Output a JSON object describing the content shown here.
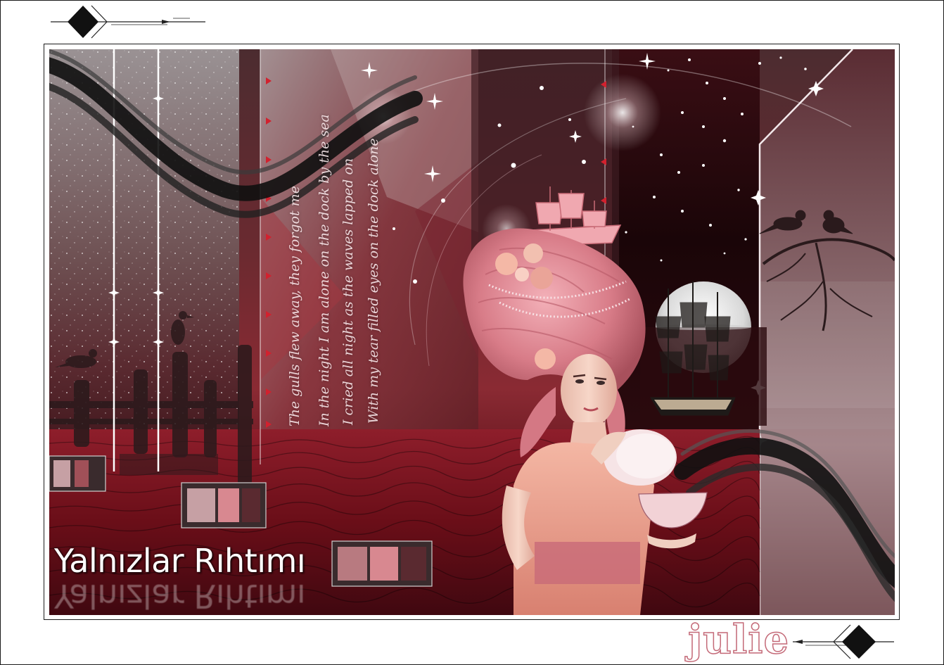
{
  "artwork": {
    "title": "Yalnızlar Rıhtımı",
    "signature": "julie",
    "poem_lines": [
      "The gulls flew away, they forgot me",
      "In the night I am alone on the dock by the sea",
      "I cried all night as the waves lapped on",
      "With my tear filled eyes on the dock alone"
    ]
  },
  "colors": {
    "frame": "#1c1c1c",
    "accent_red": "#b4353f",
    "dark_crimson": "#4a1418",
    "rose": "#e49aa3",
    "wig_pink": "#e48f98",
    "water": "#7a1420"
  },
  "icons": {
    "top_left_ornament": "diamond-arrow-ornament",
    "bottom_right_ornament": "diamond-arrow-ornament"
  }
}
